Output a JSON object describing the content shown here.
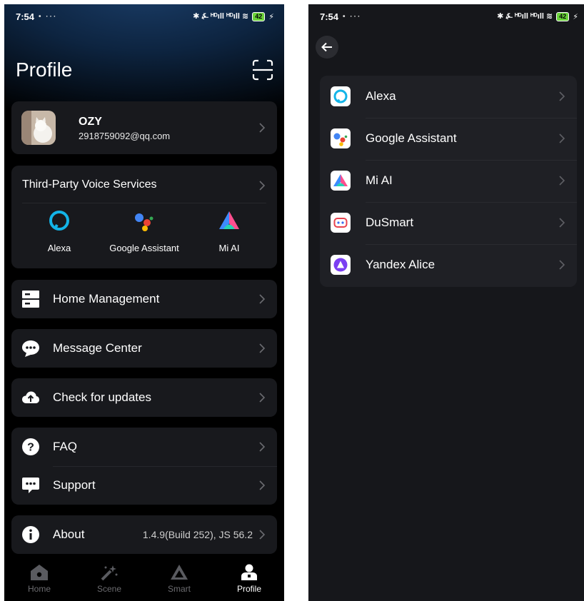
{
  "status_bar": {
    "time": "7:54",
    "dots": "• ···",
    "icons": "✱ ⍼ ᴴᴰıll ᴴᴰıll ≋",
    "battery": "42"
  },
  "profile": {
    "title": "Profile",
    "user": {
      "name": "OZY",
      "email": "2918759092@qq.com"
    },
    "voice_services": {
      "title": "Third-Party Voice Services",
      "items": [
        {
          "label": "Alexa",
          "icon": "alexa-icon"
        },
        {
          "label": "Google Assistant",
          "icon": "google-assistant-icon"
        },
        {
          "label": "Mi AI",
          "icon": "mi-ai-icon"
        }
      ]
    },
    "menu": {
      "home_management": "Home Management",
      "message_center": "Message Center",
      "check_updates": "Check for updates",
      "faq": "FAQ",
      "support": "Support",
      "about": "About",
      "about_version": "1.4.9(Build 252), JS 56.2"
    },
    "tabs": [
      {
        "label": "Home",
        "icon": "home-icon"
      },
      {
        "label": "Scene",
        "icon": "scene-icon"
      },
      {
        "label": "Smart",
        "icon": "smart-icon"
      },
      {
        "label": "Profile",
        "icon": "profile-icon",
        "active": true
      }
    ]
  },
  "voice_services_page": {
    "services": [
      {
        "label": "Alexa",
        "icon": "alexa-icon"
      },
      {
        "label": "Google Assistant",
        "icon": "google-assistant-icon"
      },
      {
        "label": "Mi AI",
        "icon": "mi-ai-icon"
      },
      {
        "label": "DuSmart",
        "icon": "dusmart-icon"
      },
      {
        "label": "Yandex Alice",
        "icon": "yandex-alice-icon"
      }
    ]
  },
  "colors": {
    "alexa": "#13b4e8",
    "mi_ai_blue": "#3d8bff",
    "mi_ai_pink": "#ff4f8f",
    "yandex": "#7b3ff2",
    "dusmart": "#e8434f",
    "battery": "#6ad33a"
  }
}
